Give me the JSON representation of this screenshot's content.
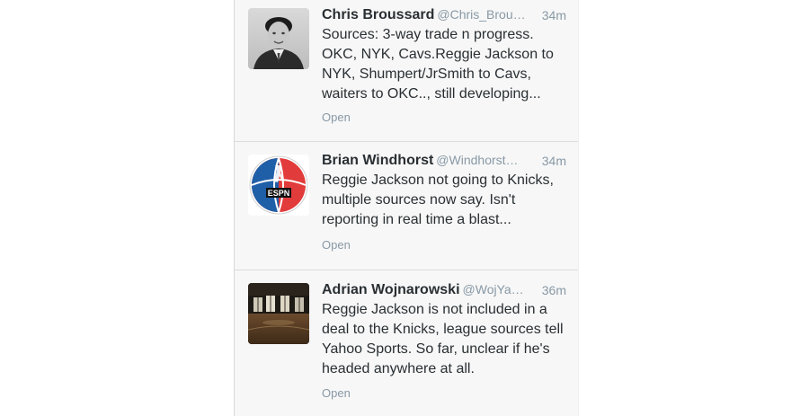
{
  "tweets": [
    {
      "name": "Chris Broussard",
      "handle": "@Chris_Brou…",
      "time": "34m",
      "text": "Sources: 3-way trade n progress. OKC, NYK, Cavs.Reggie Jackson to NYK, Shumpert/JrSmith to Cavs, waiters to OKC.., still developing...",
      "open_label": "Open",
      "avatar": "headshot-photo"
    },
    {
      "name": "Brian Windhorst",
      "handle": "@Windhorst…",
      "time": "34m",
      "text": "Reggie Jackson not going to Knicks, multiple sources now say. Isn't reporting in real time a blast...",
      "open_label": "Open",
      "avatar": "espn-nba-logo"
    },
    {
      "name": "Adrian Wojnarowski",
      "handle": "@WojYa…",
      "time": "36m",
      "text": "Reggie Jackson is not included in a deal to the Knicks, league sources tell Yahoo Sports. So far, unclear if he's headed anywhere at all.",
      "open_label": "Open",
      "avatar": "gym-photo"
    }
  ],
  "colors": {
    "name": "#292f33",
    "meta": "#8899a6",
    "feed_bg": "#f7f7f7",
    "divider": "#dcdcdc"
  }
}
